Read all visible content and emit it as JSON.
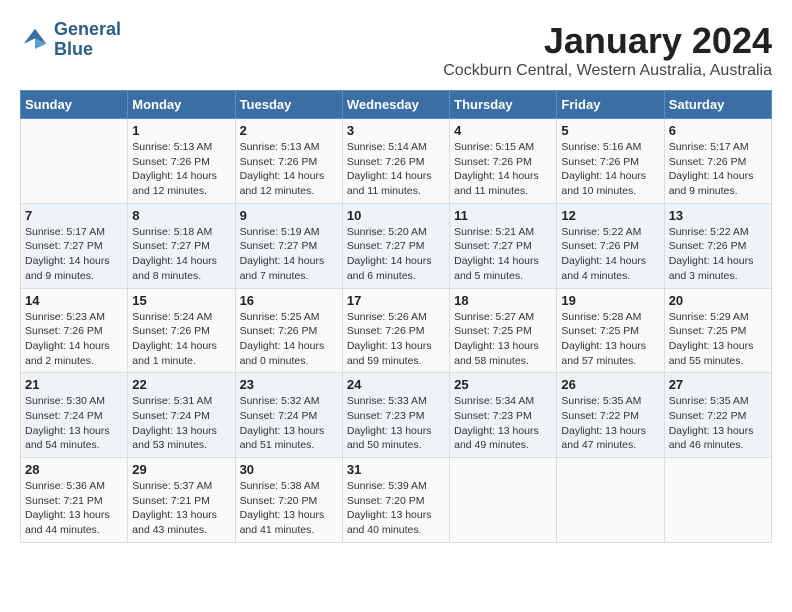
{
  "logo": {
    "line1": "General",
    "line2": "Blue"
  },
  "title": "January 2024",
  "location": "Cockburn Central, Western Australia, Australia",
  "days_of_week": [
    "Sunday",
    "Monday",
    "Tuesday",
    "Wednesday",
    "Thursday",
    "Friday",
    "Saturday"
  ],
  "weeks": [
    [
      {
        "num": "",
        "info": ""
      },
      {
        "num": "1",
        "info": "Sunrise: 5:13 AM\nSunset: 7:26 PM\nDaylight: 14 hours\nand 12 minutes."
      },
      {
        "num": "2",
        "info": "Sunrise: 5:13 AM\nSunset: 7:26 PM\nDaylight: 14 hours\nand 12 minutes."
      },
      {
        "num": "3",
        "info": "Sunrise: 5:14 AM\nSunset: 7:26 PM\nDaylight: 14 hours\nand 11 minutes."
      },
      {
        "num": "4",
        "info": "Sunrise: 5:15 AM\nSunset: 7:26 PM\nDaylight: 14 hours\nand 11 minutes."
      },
      {
        "num": "5",
        "info": "Sunrise: 5:16 AM\nSunset: 7:26 PM\nDaylight: 14 hours\nand 10 minutes."
      },
      {
        "num": "6",
        "info": "Sunrise: 5:17 AM\nSunset: 7:26 PM\nDaylight: 14 hours\nand 9 minutes."
      }
    ],
    [
      {
        "num": "7",
        "info": "Sunrise: 5:17 AM\nSunset: 7:27 PM\nDaylight: 14 hours\nand 9 minutes."
      },
      {
        "num": "8",
        "info": "Sunrise: 5:18 AM\nSunset: 7:27 PM\nDaylight: 14 hours\nand 8 minutes."
      },
      {
        "num": "9",
        "info": "Sunrise: 5:19 AM\nSunset: 7:27 PM\nDaylight: 14 hours\nand 7 minutes."
      },
      {
        "num": "10",
        "info": "Sunrise: 5:20 AM\nSunset: 7:27 PM\nDaylight: 14 hours\nand 6 minutes."
      },
      {
        "num": "11",
        "info": "Sunrise: 5:21 AM\nSunset: 7:27 PM\nDaylight: 14 hours\nand 5 minutes."
      },
      {
        "num": "12",
        "info": "Sunrise: 5:22 AM\nSunset: 7:26 PM\nDaylight: 14 hours\nand 4 minutes."
      },
      {
        "num": "13",
        "info": "Sunrise: 5:22 AM\nSunset: 7:26 PM\nDaylight: 14 hours\nand 3 minutes."
      }
    ],
    [
      {
        "num": "14",
        "info": "Sunrise: 5:23 AM\nSunset: 7:26 PM\nDaylight: 14 hours\nand 2 minutes."
      },
      {
        "num": "15",
        "info": "Sunrise: 5:24 AM\nSunset: 7:26 PM\nDaylight: 14 hours\nand 1 minute."
      },
      {
        "num": "16",
        "info": "Sunrise: 5:25 AM\nSunset: 7:26 PM\nDaylight: 14 hours\nand 0 minutes."
      },
      {
        "num": "17",
        "info": "Sunrise: 5:26 AM\nSunset: 7:26 PM\nDaylight: 13 hours\nand 59 minutes."
      },
      {
        "num": "18",
        "info": "Sunrise: 5:27 AM\nSunset: 7:25 PM\nDaylight: 13 hours\nand 58 minutes."
      },
      {
        "num": "19",
        "info": "Sunrise: 5:28 AM\nSunset: 7:25 PM\nDaylight: 13 hours\nand 57 minutes."
      },
      {
        "num": "20",
        "info": "Sunrise: 5:29 AM\nSunset: 7:25 PM\nDaylight: 13 hours\nand 55 minutes."
      }
    ],
    [
      {
        "num": "21",
        "info": "Sunrise: 5:30 AM\nSunset: 7:24 PM\nDaylight: 13 hours\nand 54 minutes."
      },
      {
        "num": "22",
        "info": "Sunrise: 5:31 AM\nSunset: 7:24 PM\nDaylight: 13 hours\nand 53 minutes."
      },
      {
        "num": "23",
        "info": "Sunrise: 5:32 AM\nSunset: 7:24 PM\nDaylight: 13 hours\nand 51 minutes."
      },
      {
        "num": "24",
        "info": "Sunrise: 5:33 AM\nSunset: 7:23 PM\nDaylight: 13 hours\nand 50 minutes."
      },
      {
        "num": "25",
        "info": "Sunrise: 5:34 AM\nSunset: 7:23 PM\nDaylight: 13 hours\nand 49 minutes."
      },
      {
        "num": "26",
        "info": "Sunrise: 5:35 AM\nSunset: 7:22 PM\nDaylight: 13 hours\nand 47 minutes."
      },
      {
        "num": "27",
        "info": "Sunrise: 5:35 AM\nSunset: 7:22 PM\nDaylight: 13 hours\nand 46 minutes."
      }
    ],
    [
      {
        "num": "28",
        "info": "Sunrise: 5:36 AM\nSunset: 7:21 PM\nDaylight: 13 hours\nand 44 minutes."
      },
      {
        "num": "29",
        "info": "Sunrise: 5:37 AM\nSunset: 7:21 PM\nDaylight: 13 hours\nand 43 minutes."
      },
      {
        "num": "30",
        "info": "Sunrise: 5:38 AM\nSunset: 7:20 PM\nDaylight: 13 hours\nand 41 minutes."
      },
      {
        "num": "31",
        "info": "Sunrise: 5:39 AM\nSunset: 7:20 PM\nDaylight: 13 hours\nand 40 minutes."
      },
      {
        "num": "",
        "info": ""
      },
      {
        "num": "",
        "info": ""
      },
      {
        "num": "",
        "info": ""
      }
    ]
  ]
}
